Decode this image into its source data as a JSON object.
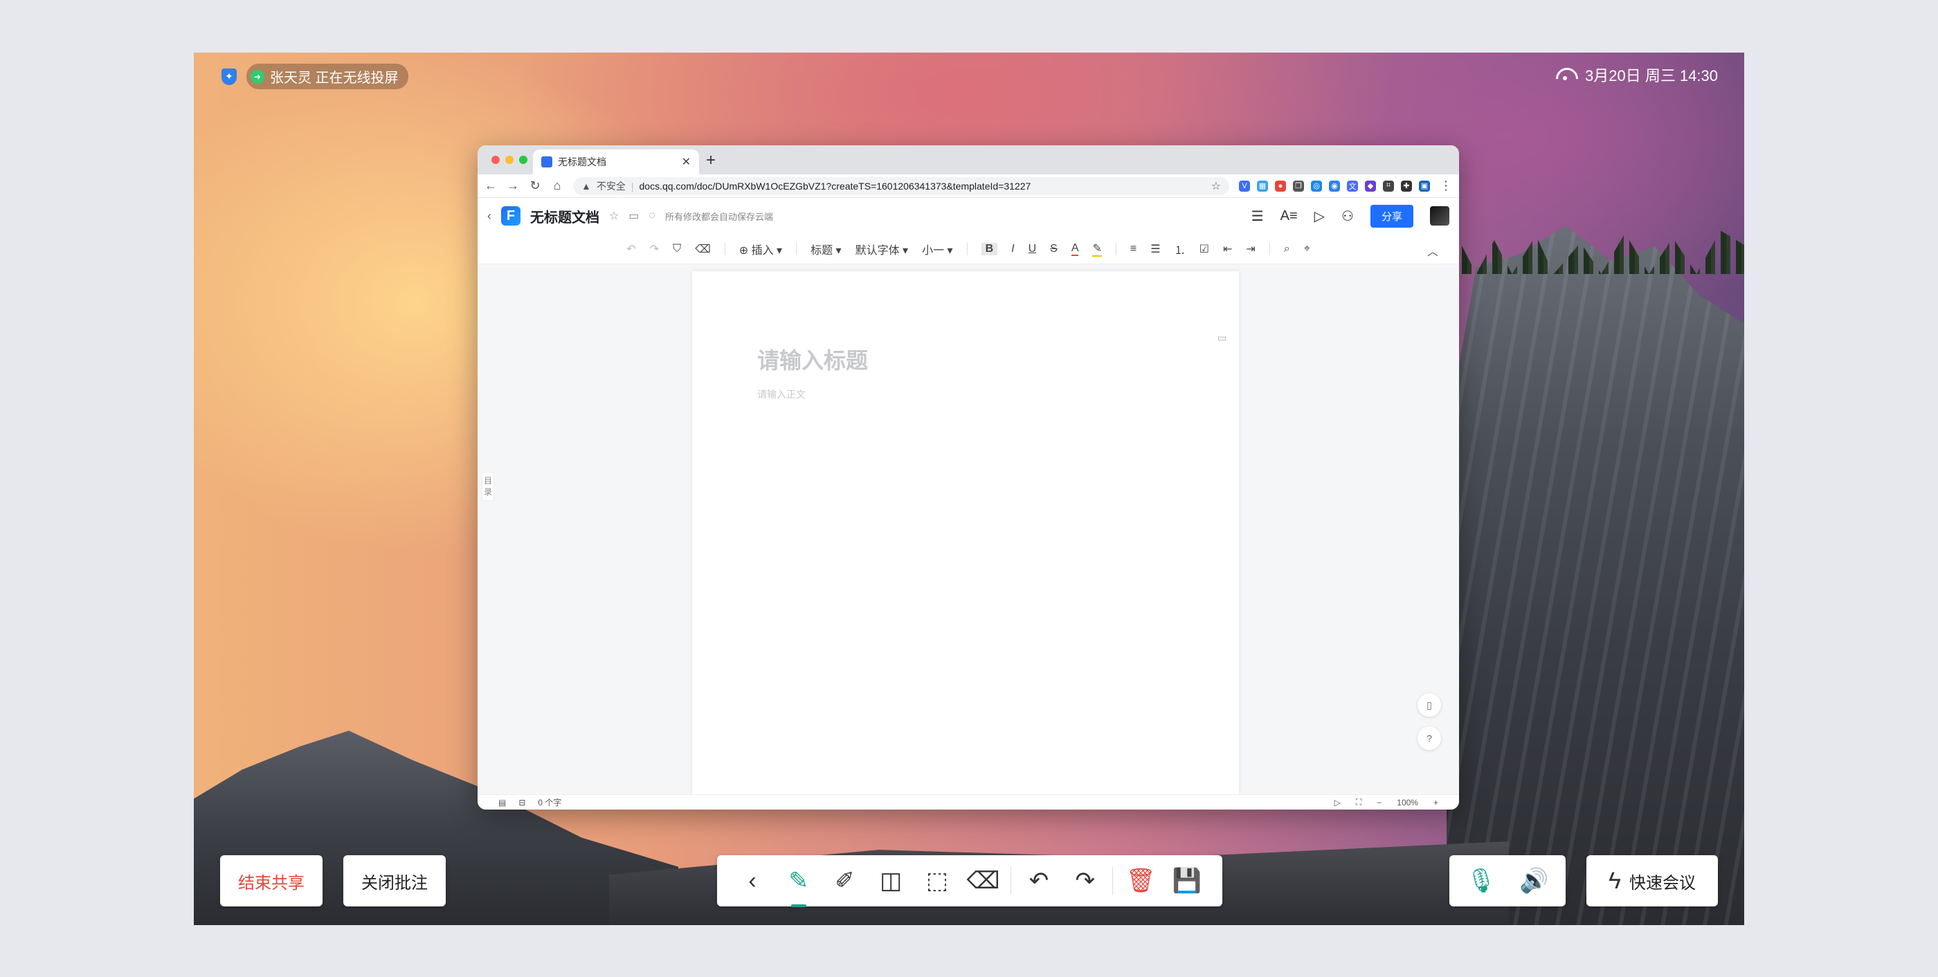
{
  "status_bar": {
    "cast_text": "张天灵 正在无线投屏",
    "datetime": "3月20日 周三 14:30"
  },
  "browser": {
    "tab_title": "无标题文档",
    "new_tab": "+",
    "insecure_label": "不安全",
    "url": "docs.qq.com/doc/DUmRXbW1OcEZGbVZ1?createTS=1601206341373&templateId=31227"
  },
  "doc_app": {
    "title": "无标题文档",
    "save_status": "所有修改都会自动保存云端",
    "share_label": "分享",
    "toolbar": {
      "insert": "插入",
      "style": "标题",
      "font": "默认字体",
      "size": "小一"
    },
    "title_placeholder": "请输入标题",
    "body_placeholder": "请输入正文",
    "toc_label": "目录",
    "word_count": "0 个字",
    "zoom": "100%"
  },
  "controls": {
    "end_share": "结束共享",
    "close_annotation": "关闭批注",
    "quick_meeting": "快速会议"
  },
  "colors": {
    "accent_green": "#1aa38b",
    "danger_red": "#e8453c",
    "brand_blue": "#1e6fff"
  }
}
